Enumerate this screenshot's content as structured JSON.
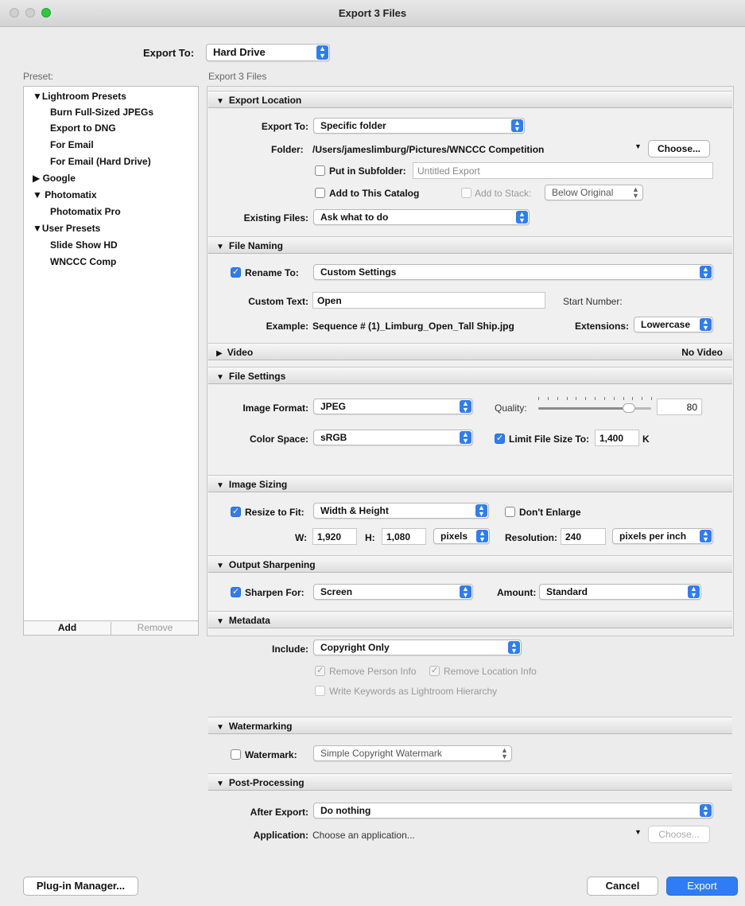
{
  "window": {
    "title": "Export 3 Files"
  },
  "export_to": {
    "label": "Export To:",
    "value": "Hard Drive"
  },
  "preset": {
    "label": "Preset:",
    "tree": [
      {
        "label": "▼Lightroom Presets"
      },
      {
        "label": "Burn Full-Sized JPEGs"
      },
      {
        "label": "Export to DNG"
      },
      {
        "label": "For Email"
      },
      {
        "label": "For Email (Hard Drive)"
      },
      {
        "label": "▶ Google"
      },
      {
        "label": "▼ Photomatix"
      },
      {
        "label": "Photomatix Pro"
      },
      {
        "label": "▼User Presets"
      },
      {
        "label": "Slide Show HD"
      },
      {
        "label": "WNCCC Comp"
      }
    ],
    "add_label": "Add",
    "remove_label": "Remove"
  },
  "main_header": "Export 3 Files",
  "sections": {
    "export_location": {
      "title": "Export Location",
      "export_to_label": "Export To:",
      "export_to_value": "Specific folder",
      "folder_label": "Folder:",
      "folder_value": "/Users/jameslimburg/Pictures/WNCCC Competition",
      "choose_label": "Choose...",
      "subfolder_label": "Put in Subfolder:",
      "subfolder_value": "Untitled Export",
      "catalog_label": "Add to This Catalog",
      "stack_label": "Add to Stack:",
      "stack_value": "Below Original",
      "existing_label": "Existing Files:",
      "existing_value": "Ask what to do"
    },
    "file_naming": {
      "title": "File Naming",
      "rename_label": "Rename To:",
      "rename_value": "Custom Settings",
      "custom_text_label": "Custom Text:",
      "custom_text_value": "Open",
      "start_number_label": "Start Number:",
      "example_label": "Example:",
      "example_value": "Sequence # (1)_Limburg_Open_Tall Ship.jpg",
      "extensions_label": "Extensions:",
      "extensions_value": "Lowercase"
    },
    "video": {
      "title": "Video",
      "status": "No Video"
    },
    "file_settings": {
      "title": "File Settings",
      "format_label": "Image Format:",
      "format_value": "JPEG",
      "quality_label": "Quality:",
      "quality_value": "80",
      "quality_fraction": 0.8,
      "color_space_label": "Color Space:",
      "color_space_value": "sRGB",
      "limit_label": "Limit File Size To:",
      "limit_value": "1,400",
      "limit_unit": "K"
    },
    "image_sizing": {
      "title": "Image Sizing",
      "resize_label": "Resize to Fit:",
      "resize_value": "Width & Height",
      "dont_enlarge_label": "Don't Enlarge",
      "w_label": "W:",
      "w_value": "1,920",
      "h_label": "H:",
      "h_value": "1,080",
      "unit_value": "pixels",
      "resolution_label": "Resolution:",
      "resolution_value": "240",
      "res_unit_value": "pixels per inch"
    },
    "output_sharpening": {
      "title": "Output Sharpening",
      "sharpen_label": "Sharpen For:",
      "sharpen_value": "Screen",
      "amount_label": "Amount:",
      "amount_value": "Standard"
    },
    "metadata": {
      "title": "Metadata",
      "include_label": "Include:",
      "include_value": "Copyright Only",
      "remove_person_label": "Remove Person Info",
      "remove_location_label": "Remove Location Info",
      "keywords_label": "Write Keywords as Lightroom Hierarchy"
    },
    "watermarking": {
      "title": "Watermarking",
      "watermark_label": "Watermark:",
      "watermark_value": "Simple Copyright Watermark"
    },
    "post_processing": {
      "title": "Post-Processing",
      "after_export_label": "After Export:",
      "after_export_value": "Do nothing",
      "application_label": "Application:",
      "application_value": "Choose an application...",
      "choose_label": "Choose..."
    }
  },
  "footer": {
    "plugin_manager_label": "Plug-in Manager...",
    "cancel_label": "Cancel",
    "export_label": "Export"
  },
  "colors": {
    "accent": "#2f7df6",
    "window_bg": "#ececec"
  }
}
